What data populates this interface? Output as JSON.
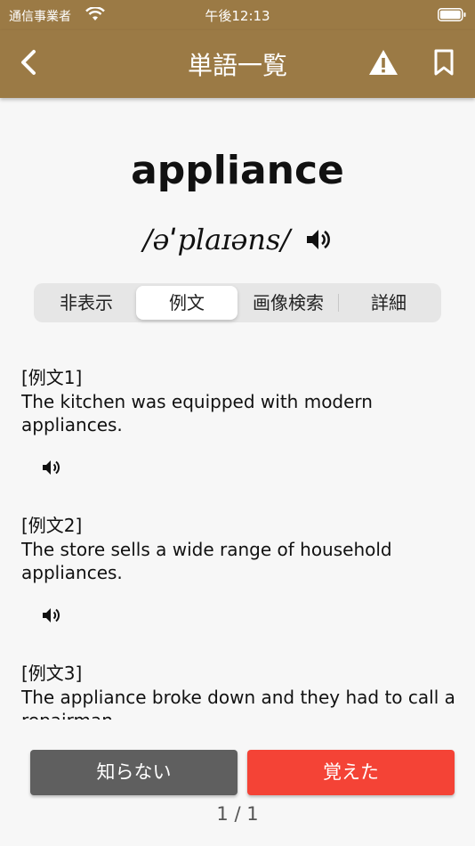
{
  "status_bar": {
    "carrier": "通信事業者",
    "time": "午後12:13"
  },
  "navbar": {
    "title": "単語一覧"
  },
  "word": {
    "headword": "appliance",
    "pronunciation": "/əˈplaɪəns/"
  },
  "tabs": [
    {
      "label": "非表示",
      "active": false
    },
    {
      "label": "例文",
      "active": true
    },
    {
      "label": "画像検索",
      "active": false
    },
    {
      "label": "詳細",
      "active": false
    }
  ],
  "examples": [
    {
      "label": "[例文1]",
      "text": "The kitchen was equipped with modern appliances."
    },
    {
      "label": "[例文2]",
      "text": "The store sells a wide range of household appliances."
    },
    {
      "label": "[例文3]",
      "text": "The appliance broke down and they had to call a repairman."
    }
  ],
  "buttons": {
    "unknown": "知らない",
    "learned": "覚えた"
  },
  "pager": "1 / 1",
  "colors": {
    "header": "#9b7a45",
    "learned": "#f44336",
    "unknown": "#5f5f5f"
  },
  "icons": {
    "back": "chevron-left-icon",
    "warning": "warning-icon",
    "bookmark": "bookmark-icon",
    "speaker": "speaker-icon"
  }
}
